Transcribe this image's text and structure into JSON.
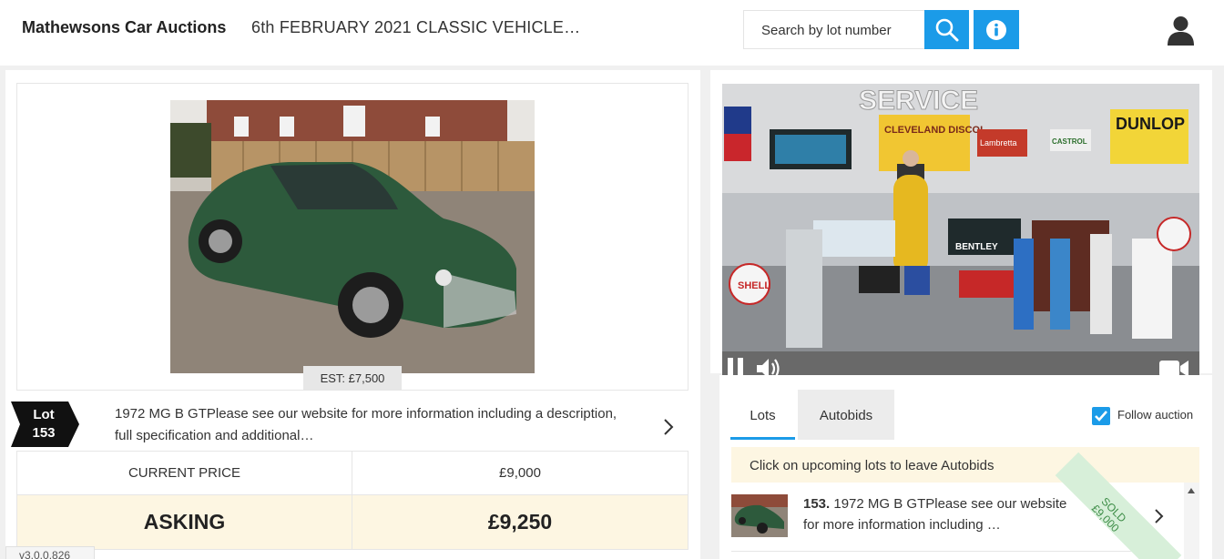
{
  "header": {
    "brand": "Mathewsons Car Auctions",
    "sale_title": "6th FEBRUARY 2021 CLASSIC VEHICLE…",
    "search_placeholder": "Search by lot number",
    "accent": "#1b9be8",
    "icons": [
      "search-icon",
      "info-icon",
      "user-icon"
    ]
  },
  "lot": {
    "estimate": "EST: £7,500",
    "badge_label": "Lot",
    "badge_number": "153",
    "description": "1972 MG B GTPlease see our website for more information including a description, full specification and additional…",
    "current_price_label": "CURRENT PRICE",
    "current_price": "£9,000",
    "asking_label": "ASKING",
    "asking_price": "£9,250"
  },
  "video": {
    "controls": [
      "pause-icon",
      "volume-icon",
      "camera-icon"
    ],
    "sign_texts": [
      "SERVICE",
      "CLEVELAND DISCOL",
      "DUNLOP",
      "BENTLEY",
      "SHELL",
      "Lambretta",
      "CASTROL"
    ]
  },
  "tabs": [
    {
      "label": "Lots",
      "active": true
    },
    {
      "label": "Autobids",
      "active": false
    }
  ],
  "follow": {
    "label": "Follow auction",
    "checked": true
  },
  "lots_panel": {
    "hint": "Click on upcoming lots to leave Autobids",
    "rows": [
      {
        "number": "153.",
        "text": "1972 MG B GTPlease see our website for more information including …",
        "status": "SOLD",
        "sold_price": "£9,000"
      }
    ]
  },
  "version": "v3.0.0.826"
}
